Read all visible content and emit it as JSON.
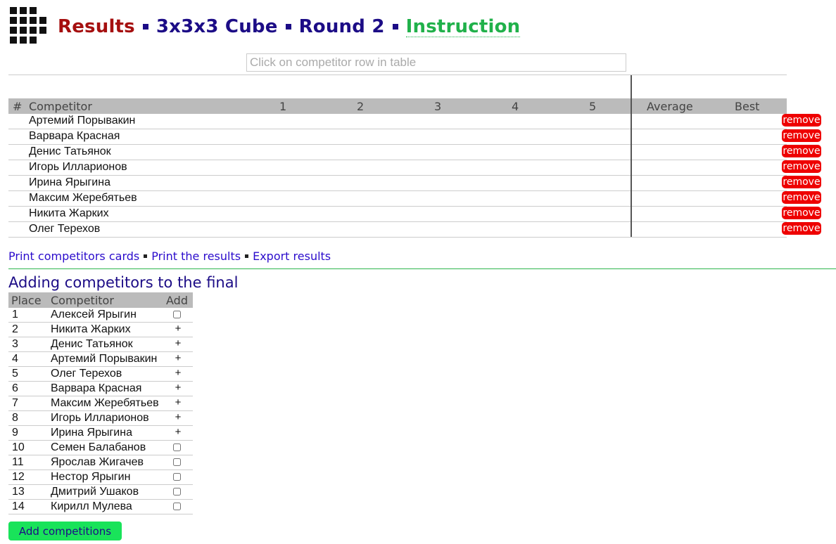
{
  "header": {
    "results": "Results",
    "event": "3x3x3 Cube",
    "round": "Round 2",
    "instruction": "Instruction"
  },
  "search": {
    "placeholder": "Click on competitor row in table"
  },
  "results_table": {
    "headers": [
      "#",
      "Competitor",
      "1",
      "2",
      "3",
      "4",
      "5",
      "Average",
      "Best"
    ],
    "rows": [
      "Артемий Порывакин",
      "Варвара Красная",
      "Денис Татьянок",
      "Игорь Илларионов",
      "Ирина Ярыгина",
      "Максим Жеребятьев",
      "Никита Жарких",
      "Олег Терехов"
    ],
    "remove_label": "remove"
  },
  "actions": {
    "print_cards": "Print competitors cards",
    "print_results": "Print the results",
    "export": "Export results"
  },
  "final": {
    "title": "Adding competitors to the final",
    "headers": [
      "Place",
      "Competitor",
      "Add"
    ],
    "rows": [
      {
        "place": "1",
        "name": "Алексей Ярыгин",
        "added": false
      },
      {
        "place": "2",
        "name": "Никита Жарких",
        "added": true
      },
      {
        "place": "3",
        "name": "Денис Татьянок",
        "added": true
      },
      {
        "place": "4",
        "name": "Артемий Порывакин",
        "added": true
      },
      {
        "place": "5",
        "name": "Олег Терехов",
        "added": true
      },
      {
        "place": "6",
        "name": "Варвара Красная",
        "added": true
      },
      {
        "place": "7",
        "name": "Максим Жеребятьев",
        "added": true
      },
      {
        "place": "8",
        "name": "Игорь Илларионов",
        "added": true
      },
      {
        "place": "9",
        "name": "Ирина Ярыгина",
        "added": true
      },
      {
        "place": "10",
        "name": "Семен Балабанов",
        "added": false
      },
      {
        "place": "11",
        "name": "Ярослав Жигачев",
        "added": false
      },
      {
        "place": "12",
        "name": "Нестор Ярыгин",
        "added": false
      },
      {
        "place": "13",
        "name": "Дмитрий Ушаков",
        "added": false
      },
      {
        "place": "14",
        "name": "Кирилл Мулева",
        "added": false
      }
    ],
    "added_mark": "+",
    "button_label": "Add competitions"
  },
  "colors": {
    "results": "#a50f0f",
    "nav": "#1c0c86",
    "instruction": "#20b14a",
    "remove": "#ee0000",
    "add_button": "#19e35a"
  }
}
